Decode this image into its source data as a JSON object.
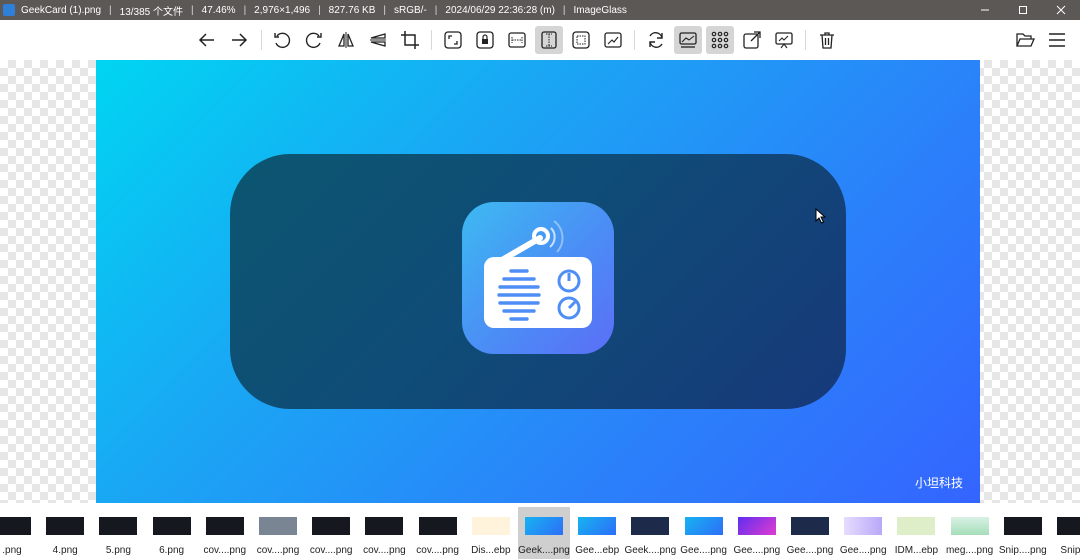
{
  "titlebar": {
    "filename": "GeekCard (1).png",
    "position": "13/385 个文件",
    "zoom": "47.46%",
    "dimensions": "2,976×1,496",
    "filesize": "827.76 KB",
    "colorprofile": "sRGB/-",
    "datetime": "2024/06/29 22:36:28 (m)",
    "appname": "ImageGlass"
  },
  "toolbar": {
    "buttons": [
      "back-arrow-icon",
      "forward-arrow-icon",
      "rotate-left-icon",
      "rotate-right-icon",
      "flip-horizontal-icon",
      "flip-vertical-icon",
      "crop-icon",
      "auto-zoom-icon",
      "lock-zoom-icon",
      "scale-to-width-icon",
      "scale-to-height-icon",
      "scale-to-fit-icon",
      "scale-to-fill-icon",
      "refresh-icon",
      "gallery-icon",
      "checkerboard-icon",
      "fullscreen-icon",
      "slideshow-icon",
      "delete-icon",
      "open-folder-icon",
      "menu-icon"
    ]
  },
  "viewer": {
    "watermark": "小坦科技"
  },
  "thumbnails": [
    {
      "label": ".png",
      "style": "dark"
    },
    {
      "label": "4.png",
      "style": "dark"
    },
    {
      "label": "5.png",
      "style": "dark"
    },
    {
      "label": "6.png",
      "style": "dark"
    },
    {
      "label": "cov....png",
      "style": "dark"
    },
    {
      "label": "cov....png",
      "style": "gray"
    },
    {
      "label": "cov....png",
      "style": "dark"
    },
    {
      "label": "cov....png",
      "style": "dark"
    },
    {
      "label": "cov....png",
      "style": "dark"
    },
    {
      "label": "Dis...ebp",
      "style": "orange"
    },
    {
      "label": "Geek....png",
      "style": "blue",
      "selected": true
    },
    {
      "label": "Gee...ebp",
      "style": "blue"
    },
    {
      "label": "Geek....png",
      "style": "navy"
    },
    {
      "label": "Gee....png",
      "style": "blue"
    },
    {
      "label": "Gee....png",
      "style": "purple"
    },
    {
      "label": "Gee....png",
      "style": "navy"
    },
    {
      "label": "Gee....png",
      "style": "lilac"
    },
    {
      "label": "IDM...ebp",
      "style": "green"
    },
    {
      "label": "meg....png",
      "style": "mint"
    },
    {
      "label": "Snip....png",
      "style": "dark"
    },
    {
      "label": "Snip....",
      "style": "dark"
    }
  ],
  "colors": {
    "titlebar": "#5c5856",
    "accent_blue": "#2b80fa",
    "card": "#0f4c77",
    "thumb_selected": "#cfcfcf"
  }
}
